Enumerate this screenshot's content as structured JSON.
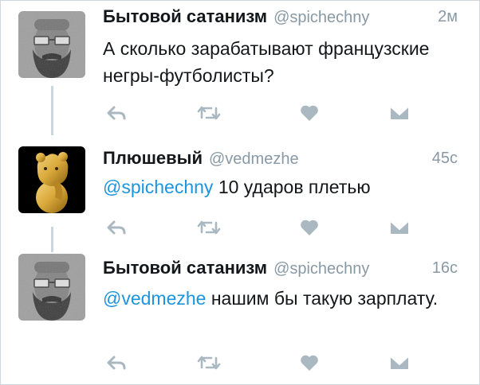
{
  "tweets": [
    {
      "name": "Бытовой сатанизм",
      "handle": "@spichechny",
      "time": "2м",
      "text": "А сколько зарабатывают французские негры-футболисты?",
      "avatar": "bearded-man-with-glasses"
    },
    {
      "name": "Плюшевый",
      "handle": "@vedmezhe",
      "time": "45с",
      "mention": "@spichechny",
      "text": "10 ударов плетью",
      "avatar": "golden-bear-statue"
    },
    {
      "name": "Бытовой сатанизм",
      "handle": "@spichechny",
      "time": "16с",
      "mention": "@vedmezhe",
      "text": "нашим бы такую зарплату.",
      "avatar": "bearded-man-with-glasses"
    }
  ],
  "icons": {
    "reply": "reply-icon",
    "retweet": "retweet-icon",
    "like": "heart-icon",
    "message": "direct-message-icon"
  },
  "colors": {
    "name": "#14171a",
    "meta": "#8899a6",
    "mention": "#1b95e0",
    "icon": "#aab8c2",
    "thread_line": "#ccd6dd"
  }
}
